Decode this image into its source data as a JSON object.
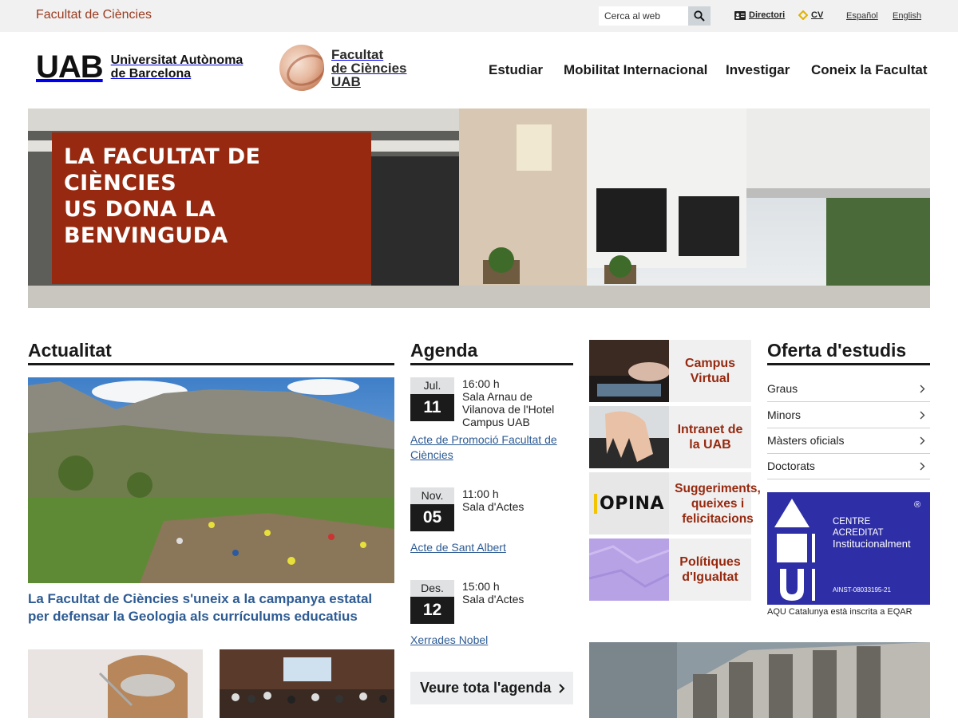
{
  "topbar": {
    "faculty_link": "Facultat de Ciències",
    "search": {
      "placeholder": "Cerca al web",
      "icon": "search-icon"
    },
    "utilities": [
      {
        "label": "Directori",
        "icon": "directory-card-icon"
      },
      {
        "label": "CV",
        "icon": "diamond-icon"
      }
    ],
    "languages": [
      "Español",
      "English"
    ]
  },
  "header": {
    "uab_mark": "UAB",
    "uab_name_line1": "Universitat Autònoma",
    "uab_name_line2": "de Barcelona",
    "faculty_line1": "Facultat",
    "faculty_line2": "de Ciències",
    "faculty_line3": "UAB",
    "nav": [
      "Estudiar",
      "Mobilitat Internacional",
      "Investigar",
      "Coneix la Facultat"
    ]
  },
  "hero": {
    "title": "LA FACULTAT DE CIÈNCIES\nUS DONA LA BENVINGUDA"
  },
  "actualitat": {
    "heading": "Actualitat",
    "headline": "La Facultat de Ciències s'uneix a la campanya estatal per defensar la Geologia als currículums educatius"
  },
  "agenda": {
    "heading": "Agenda",
    "events": [
      {
        "month": "Jul.",
        "day": "11",
        "time": "16:00 h",
        "place": "Sala Arnau de Vilanova de l'Hotel Campus UAB",
        "title": "Acte de Promoció Facultat de Ciències"
      },
      {
        "month": "Nov.",
        "day": "05",
        "time": "11:00 h",
        "place": "Sala d'Actes",
        "title": "Acte de Sant Albert"
      },
      {
        "month": "Des.",
        "day": "12",
        "time": "15:00 h",
        "place": "Sala d'Actes",
        "title": "Xerrades Nobel"
      }
    ],
    "more": "Veure tota l'agenda",
    "more_icon": "chevron-right-icon"
  },
  "quick_links": [
    {
      "label": "Campus Virtual"
    },
    {
      "label": "Intranet de la UAB"
    },
    {
      "label": "Suggeriments, queixes i felicitacions",
      "logo_text": "OPINA"
    },
    {
      "label": "Polítiques d'Igualtat"
    }
  ],
  "oferta": {
    "heading": "Oferta d'estudis",
    "items": [
      "Graus",
      "Minors",
      "Màsters oficials",
      "Doctorats"
    ],
    "item_icon": "chevron-right-icon"
  },
  "aqu": {
    "line1": "CENTRE",
    "line2": "ACREDITAT",
    "line3": "Institucionalment",
    "code": "AINST-08033195-21",
    "registered": "®",
    "caption": "AQU Catalunya està inscrita a EQAR"
  },
  "colors": {
    "accent_red": "#96290f",
    "link_blue": "#2d5b94",
    "aqu_blue": "#2e2ea6",
    "topbar_bg": "#f1f1f1"
  }
}
